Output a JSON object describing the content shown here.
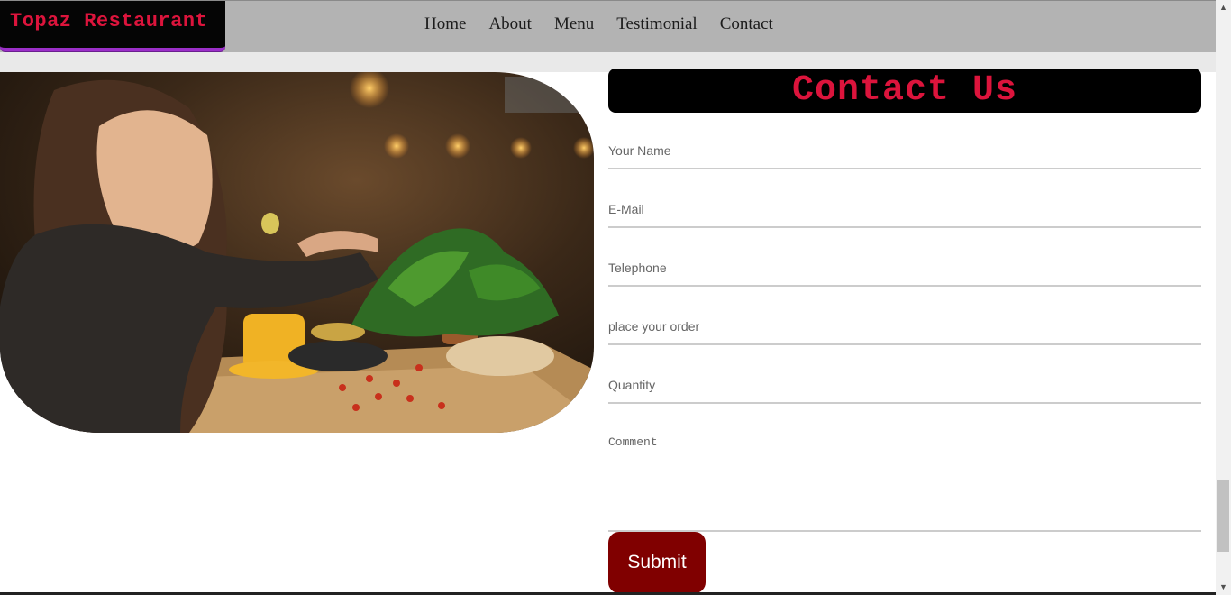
{
  "brand": {
    "name": "Topaz Restaurant"
  },
  "nav": {
    "items": [
      "Home",
      "About",
      "Menu",
      "Testimonial",
      "Contact"
    ]
  },
  "contact": {
    "title": "Contact Us",
    "fields": {
      "name": "Your Name",
      "email": "E-Mail",
      "telephone": "Telephone",
      "order": "place your order",
      "quantity": "Quantity",
      "comment": "Comment"
    },
    "submit_label": "Submit"
  },
  "colors": {
    "brand_text": "#dc143c",
    "navbar_bg": "#b3b3b3",
    "brand_underline": "#9b2fc9",
    "submit_bg": "#800000"
  },
  "icons": {
    "scroll_up": "triangle-up",
    "scroll_down": "triangle-down"
  }
}
